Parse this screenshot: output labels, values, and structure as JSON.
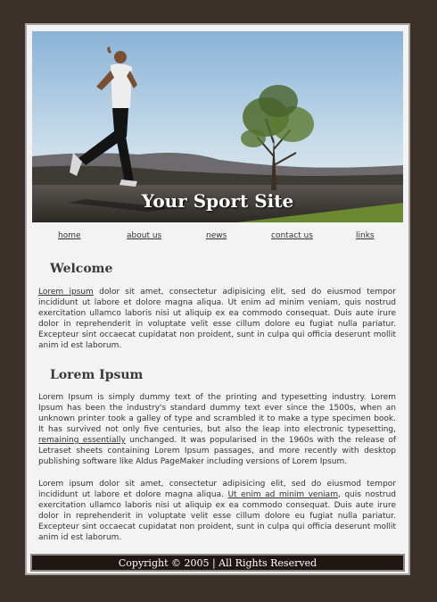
{
  "site": {
    "title": "Your Sport Site"
  },
  "nav": {
    "items": [
      {
        "label": "home"
      },
      {
        "label": "about us"
      },
      {
        "label": "news"
      },
      {
        "label": "contact us"
      },
      {
        "label": "links"
      }
    ]
  },
  "welcome": {
    "title": "Welcome",
    "para1_link": "Lorem ipsum",
    "para1_text": " dolor sit amet, consectetur adipisicing elit, sed do eiusmod tempor incididunt ut labore et dolore magna aliqua. Ut enim ad minim veniam, quis nostrud exercitation ullamco laboris nisi ut aliquip ex ea commodo consequat. Duis aute irure dolor in reprehenderit in voluptate velit esse cillum dolore eu fugiat nulla pariatur. Excepteur sint occaecat cupidatat non proident, sunt in culpa qui officia deserunt mollit anim id est laborum."
  },
  "lorem": {
    "title": "Lorem Ipsum",
    "para1_before": "Lorem Ipsum is simply dummy text of the printing and typesetting industry. Lorem Ipsum has been the industry's standard dummy text ever since the 1500s, when an unknown printer took a galley of type and scrambled it to make a type specimen book. It has survived not only five centuries, but also the leap into electronic typesetting, ",
    "para1_link": "remaining essentially",
    "para1_after": " unchanged. It was popularised in the 1960s with the release of Letraset sheets containing Lorem Ipsum passages, and more recently with desktop publishing software like Aldus PageMaker including versions of Lorem Ipsum.",
    "para2_before": "Lorem ipsum dolor sit amet, consectetur adipisicing elit, sed do eiusmod tempor incididunt ut labore et dolore magna aliqua. ",
    "para2_link": "Ut enim ad minim veniam",
    "para2_after": ", quis nostrud exercitation ullamco laboris nisi ut aliquip ex ea commodo consequat. Duis aute irure dolor in reprehenderit in voluptate velit esse cillum dolore eu fugiat nulla pariatur. Excepteur sint occaecat cupidatat non proident, sunt in culpa qui officia deserunt mollit anim id est laborum."
  },
  "footer": {
    "text": "Copyright © 2005 | All Rights Reserved"
  },
  "colors": {
    "background": "#3b302a",
    "page": "#f3f3f3",
    "footer": "#1e1714"
  }
}
